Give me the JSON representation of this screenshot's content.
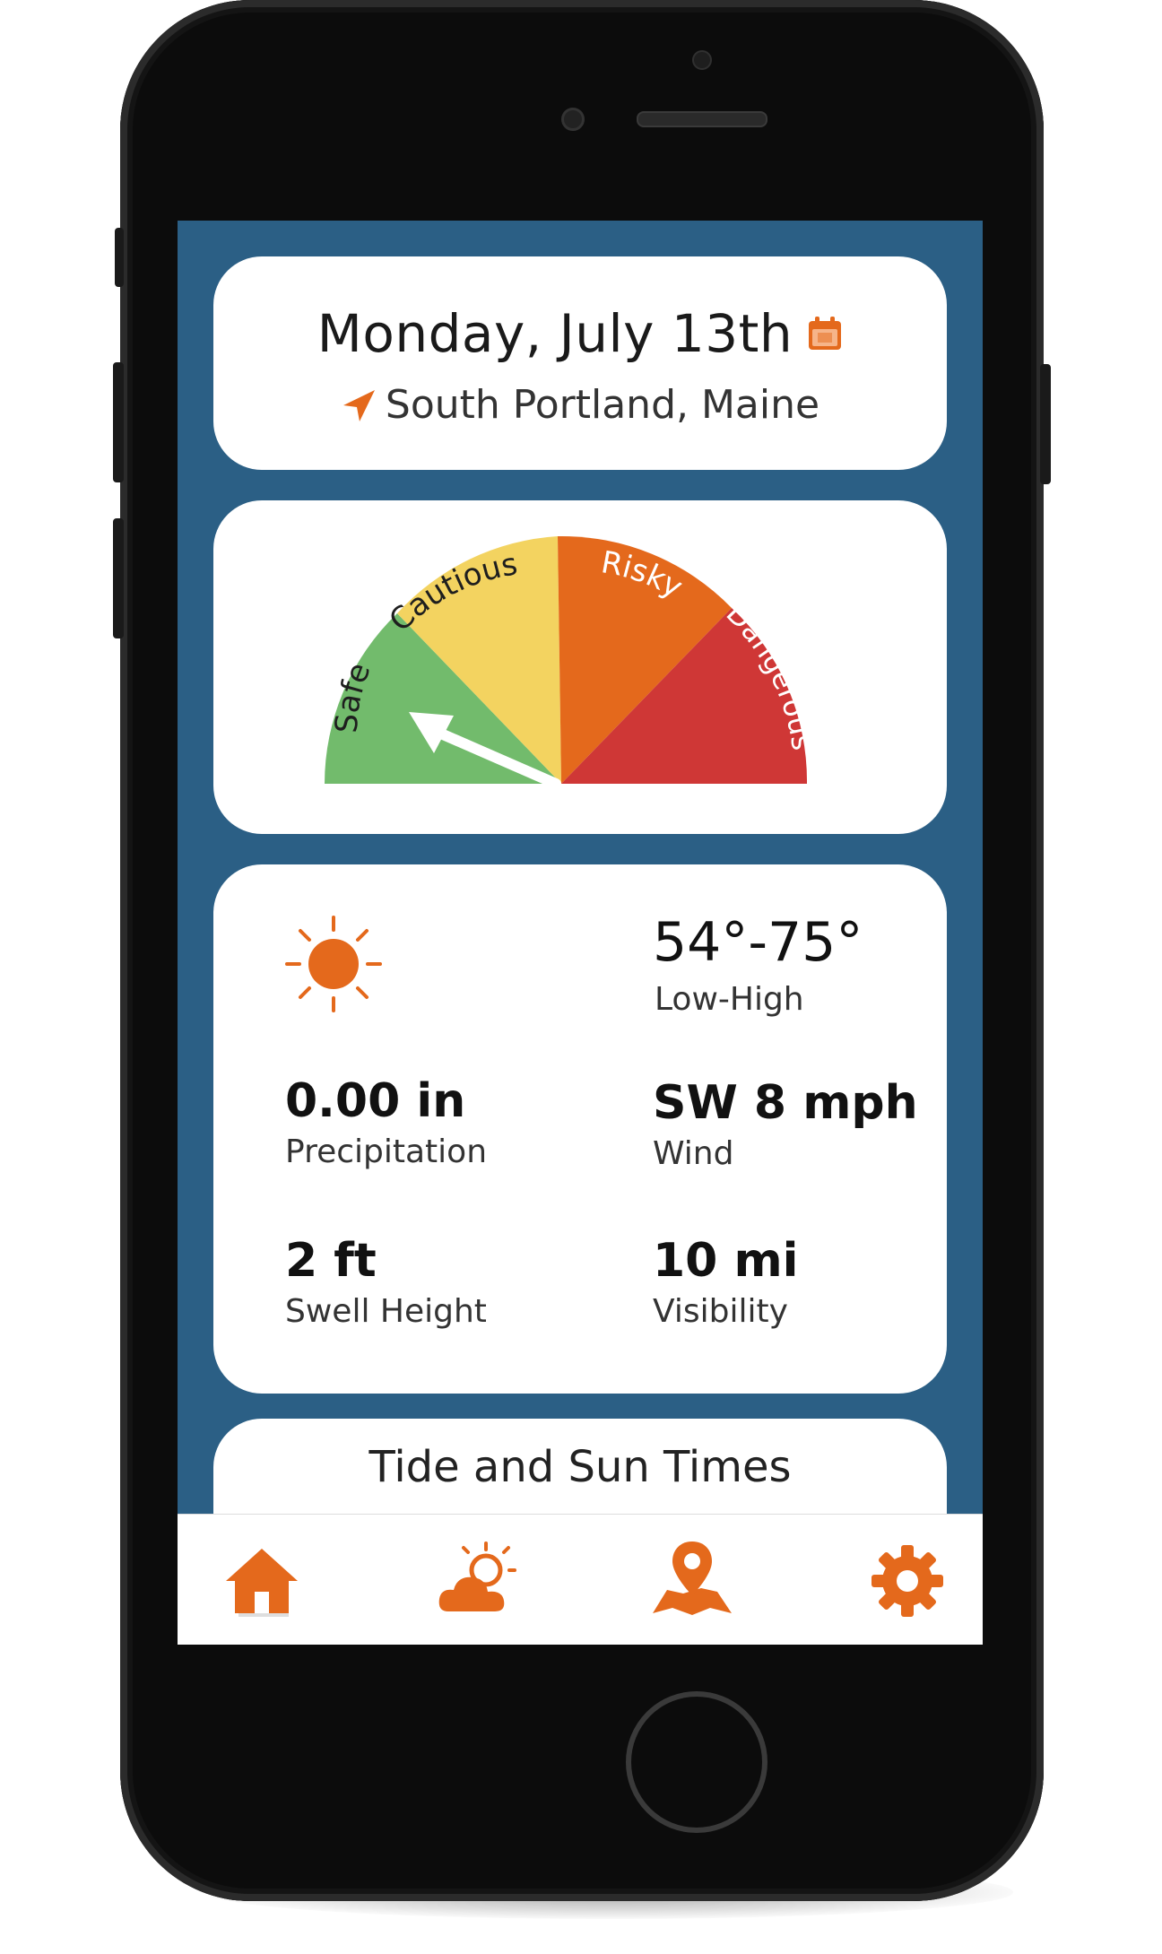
{
  "header": {
    "date": "Monday, July 13th",
    "location": "South Portland, Maine"
  },
  "gauge": {
    "labels": [
      "Safe",
      "Cautious",
      "Risky",
      "Dangerous"
    ],
    "colors": [
      "#72bb6c",
      "#f3d360",
      "#e4691c",
      "#cf3736"
    ],
    "needle_level": "Safe"
  },
  "weather": {
    "icon": "sun-icon",
    "temperature": "54°-75°",
    "temperature_label": "Low-High",
    "precipitation": "0.00 in",
    "precipitation_label": "Precipitation",
    "wind": "SW 8 mph",
    "wind_label": "Wind",
    "swell": "2 ft",
    "swell_label": "Swell Height",
    "visibility": "10 mi",
    "visibility_label": "Visibility"
  },
  "tide": {
    "title": "Tide and Sun Times"
  },
  "tabbar": {
    "items": [
      "home-icon",
      "weather-icon",
      "map-icon",
      "settings-icon"
    ],
    "accent": "#e4691c"
  },
  "colors": {
    "screen_bg": "#2b5f85",
    "accent": "#e4691c"
  }
}
